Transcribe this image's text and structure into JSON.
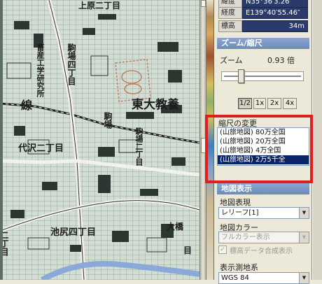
{
  "coords": {
    "lat_label": "緯度",
    "lat_value": "N35°36′3.26″",
    "lon_label": "経度",
    "lon_value": "E139°40′55.46″",
    "alt_label": "標高",
    "alt_value": "34m"
  },
  "zoom_section": {
    "header": "ズーム/縮尺",
    "zoom_label": "ズーム",
    "zoom_value": "0.93 倍",
    "zoom_level": 0.2,
    "buttons": [
      "1/2",
      "1x",
      "2x",
      "4x"
    ],
    "pressed_button": "1/2"
  },
  "scale_change": {
    "title": "縮尺の変更",
    "items": [
      "(山旅地図) 80万全国",
      "(山旅地図) 20万全国",
      "(山旅地図) 4万全国",
      "(山旅地図) 2万5千全"
    ],
    "selected_index": 3
  },
  "map_display": {
    "header": "地図表示",
    "representation_label": "地図表現",
    "representation_value": "レリーフ[1]",
    "color_label": "地図カラー",
    "color_value": "フルカラー表示",
    "elevation_checkbox_label": "標高データ合成表示",
    "elevation_checked": true
  },
  "geodetic": {
    "label": "表示測地系",
    "value": "WGS 84"
  },
  "map": {
    "labels": {
      "kamihara": "上原二丁目",
      "institute": "畜産工学研究所",
      "komaba4": "駒場四丁目",
      "higashi": "東大教養",
      "komaba": "駒場",
      "kuokawa": "駒場二丁目",
      "daizawa": "代沢二丁目",
      "ikejiri": "池尻四丁目",
      "ohashi": "大橋",
      "sen": "線",
      "niban": "二丁目",
      "tokuma": "目"
    }
  },
  "colors": {
    "highlight": "#e21d1d",
    "selection": "#0a246a",
    "header": "#7a96c4"
  }
}
